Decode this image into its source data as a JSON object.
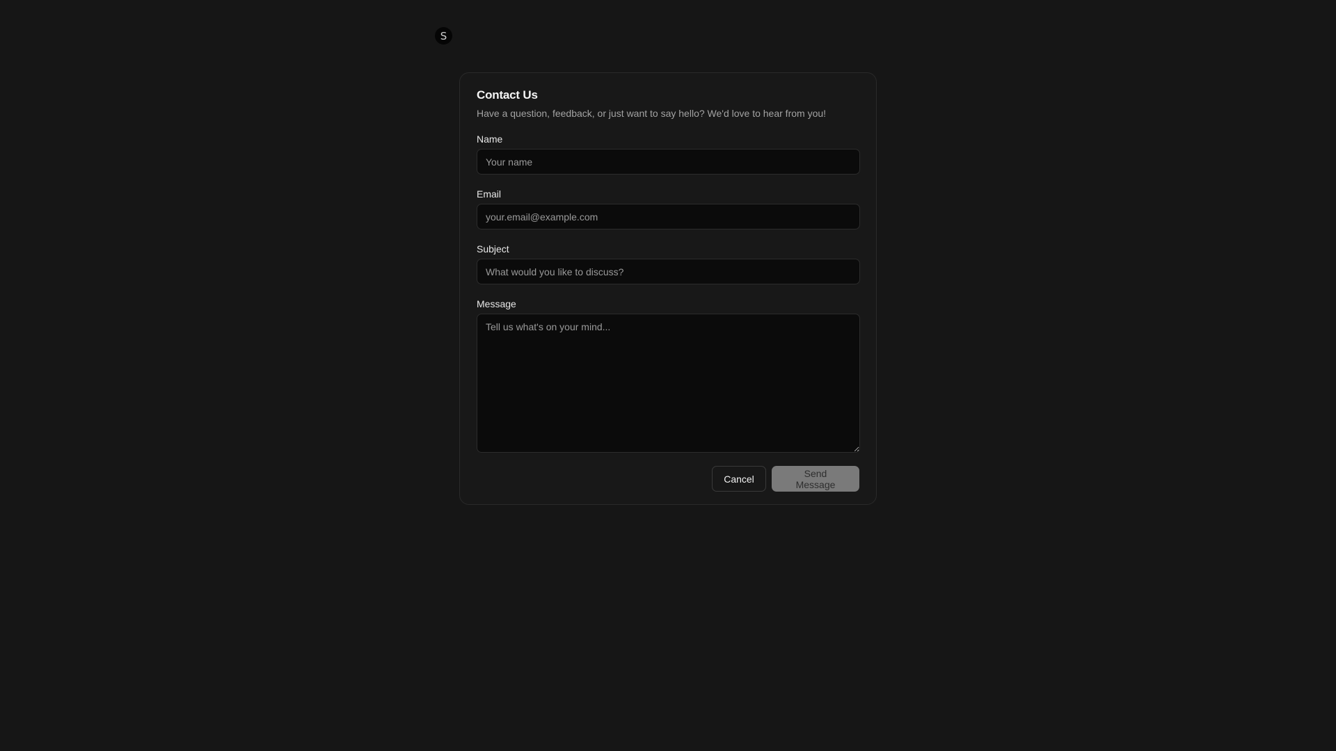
{
  "logo": {
    "letter": "S"
  },
  "form": {
    "title": "Contact Us",
    "subtitle": "Have a question, feedback, or just want to say hello? We'd love to hear from you!",
    "fields": {
      "name": {
        "label": "Name",
        "placeholder": "Your name",
        "value": ""
      },
      "email": {
        "label": "Email",
        "placeholder": "your.email@example.com",
        "value": ""
      },
      "subject": {
        "label": "Subject",
        "placeholder": "What would you like to discuss?",
        "value": ""
      },
      "message": {
        "label": "Message",
        "placeholder": "Tell us what's on your mind...",
        "value": ""
      }
    },
    "actions": {
      "cancel_label": "Cancel",
      "send_label": "Send Message"
    }
  },
  "colors": {
    "background": "#161616",
    "card": "#181818",
    "input_bg": "#0b0b0b",
    "send_button_disabled": "#7a7a7a"
  }
}
